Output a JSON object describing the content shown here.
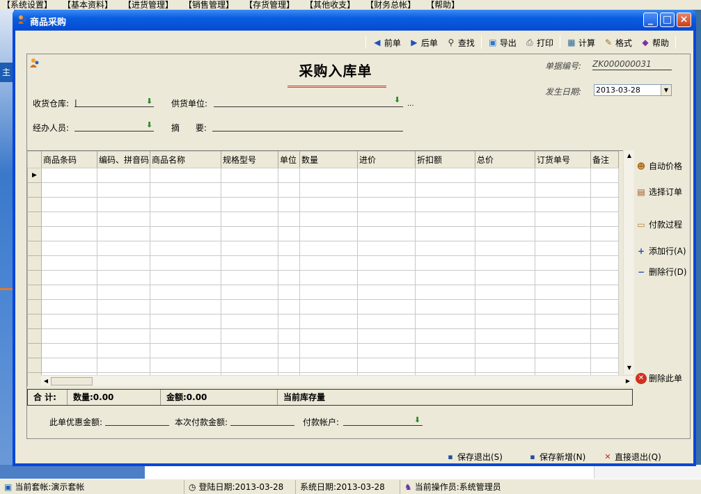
{
  "menu": [
    "【系统设置】",
    "【基本资料】",
    "【进货管理】",
    "【销售管理】",
    "【存货管理】",
    "【其他收支】",
    "【财务总帐】",
    "【帮助】"
  ],
  "bg_left_label": "主",
  "window": {
    "title": "商品采购"
  },
  "toolbar": {
    "prev": "前单",
    "next": "后单",
    "find": "查找",
    "export": "导出",
    "print": "打印",
    "calc": "计算",
    "format": "格式",
    "help": "帮助"
  },
  "form": {
    "title": "采购入库单",
    "doc_no_label": "单据编号:",
    "doc_no": "ZK000000031",
    "date_label": "发生日期:",
    "date": "2013-03-28",
    "warehouse_label": "收货仓库:",
    "warehouse_value": "|",
    "supplier_label": "供货单位:",
    "supplier_more": "...",
    "handler_label": "经办人员:",
    "summary_label": "摘      要:"
  },
  "grid": {
    "columns": [
      "商品条码",
      "编码、拼音码",
      "商品名称",
      "规格型号",
      "单位",
      "数量",
      "进价",
      "折扣额",
      "总价",
      "订货单号",
      "备注"
    ]
  },
  "side": {
    "auto_price": "自动价格",
    "select_order": "选择订单",
    "payment": "付款过程",
    "add_row": "添加行(A)",
    "delete_row": "删除行(D)",
    "delete_doc": "删除此单"
  },
  "totals": {
    "label": "合 计:",
    "qty": "数量:0.00",
    "amount": "金额:0.00",
    "stock": "当前库存量"
  },
  "bottom": {
    "discount_label": "此单优惠金额:",
    "payment_label": "本次付款金额:",
    "account_label": "付款帐户:"
  },
  "footer": {
    "save_exit": "保存退出(S)",
    "save_new": "保存新增(N)",
    "exit": "直接退出(Q)"
  },
  "status": {
    "account": "当前套帐:演示套帐",
    "login_date": "登陆日期:2013-03-28",
    "sys_date": "系统日期:2013-03-28",
    "operator": "当前操作员:系统管理员"
  }
}
